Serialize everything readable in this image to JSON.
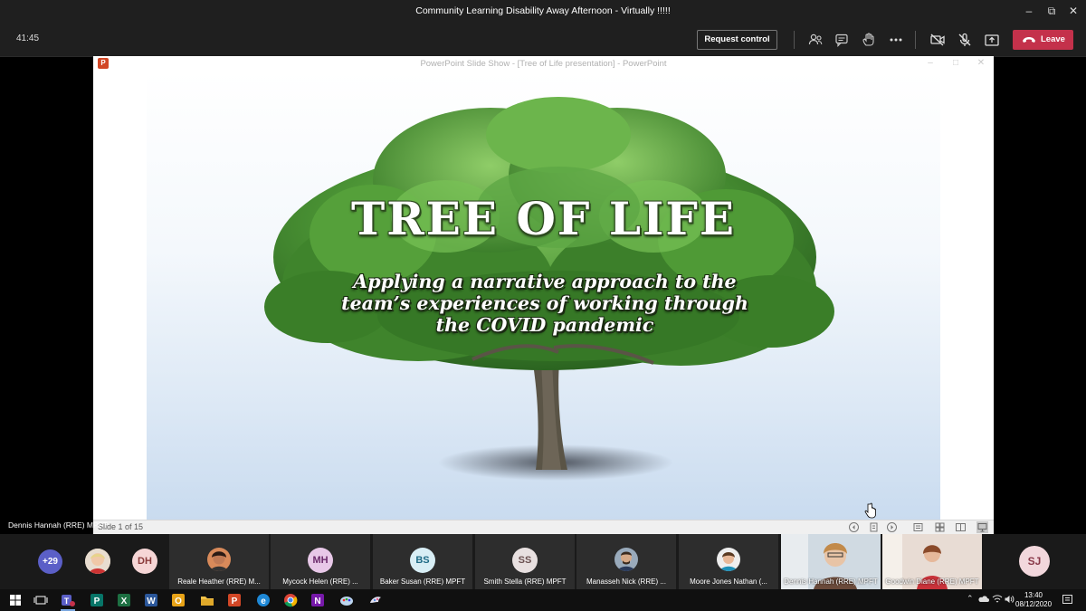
{
  "window": {
    "title": "Community Learning Disability Away Afternoon - Virtually !!!!!"
  },
  "meeting_bar": {
    "timer": "41:45",
    "request_control_label": "Request control",
    "leave_label": "Leave",
    "icons": [
      "people-icon",
      "chat-icon",
      "raise-hand-icon",
      "more-actions-icon",
      "camera-off-icon",
      "mic-off-icon",
      "share-tray-icon",
      "phone-hangup-icon"
    ],
    "leave_color": "#c4314b"
  },
  "ppt": {
    "window_title": "PowerPoint Slide Show - [Tree of Life presentation] - PowerPoint",
    "slide": {
      "title": "TREE OF LIFE",
      "subtitle_lines": [
        "Applying a narrative approach to the",
        "team’s experiences of working through",
        "the COVID pandemic"
      ]
    },
    "status": {
      "slide_number": "Slide 1 of 15",
      "icons": [
        "previous-slide-icon",
        "slide-list-icon",
        "next-slide-icon",
        "normal-view-icon",
        "slide-sorter-icon",
        "reading-view-icon",
        "slideshow-view-icon"
      ]
    }
  },
  "presenter_label": "Dennis Hannah (RRE) MPFT",
  "participants": {
    "overflow_count": "+29",
    "avatar_initials": [
      "DH"
    ],
    "tiles": [
      {
        "name": "Reale Heather (RRE) M...",
        "kind": "photo"
      },
      {
        "name": "Mycock Helen (RRE) ...",
        "kind": "initials",
        "initials": "MH",
        "color": "#e8c8e8"
      },
      {
        "name": "Baker Susan (RRE) MPFT",
        "kind": "initials",
        "initials": "BS",
        "color": "#d8eef5"
      },
      {
        "name": "Smith Stella (RRE) MPFT",
        "kind": "initials",
        "initials": "SS",
        "color": "#e8e0e0"
      },
      {
        "name": "Manasseh Nick (RRE) ...",
        "kind": "photo"
      },
      {
        "name": "Moore Jones Nathan (...",
        "kind": "photo"
      },
      {
        "name": "Dennis Hannah (RRE) MPFT",
        "kind": "video"
      },
      {
        "name": "Goodwin Diane (RRE) MPFT",
        "kind": "video"
      }
    ],
    "last_initials": "SJ"
  },
  "taskbar": {
    "apps": [
      "windows-start-icon",
      "task-view-icon",
      "teams-icon",
      "publisher-icon",
      "excel-icon",
      "word-icon",
      "outlook-icon",
      "file-explorer-icon",
      "powerpoint-icon",
      "edge-icon",
      "chrome-icon",
      "onenote-icon",
      "paint-icon"
    ],
    "clock_time": "13:40",
    "clock_date": "08/12/2020"
  }
}
